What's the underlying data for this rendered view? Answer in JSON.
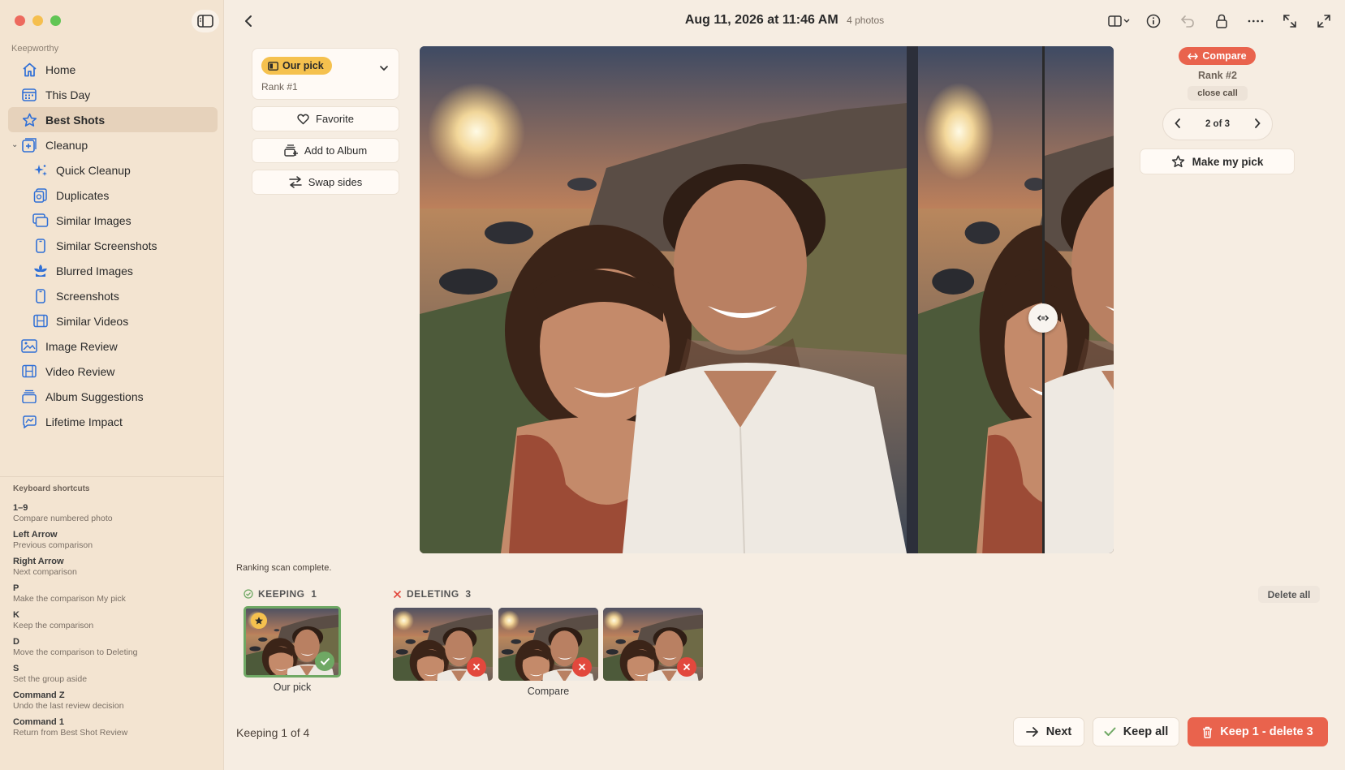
{
  "sidebar": {
    "app_name": "Keepworthy",
    "items": [
      {
        "label": "Home",
        "icon": "home-icon"
      },
      {
        "label": "This Day",
        "icon": "calendar-icon"
      },
      {
        "label": "Best Shots",
        "icon": "star-icon",
        "active": true
      },
      {
        "label": "Cleanup",
        "icon": "cleanup-icon",
        "expanded": true
      },
      {
        "label": "Quick Cleanup",
        "icon": "sparkle-icon",
        "sub": true
      },
      {
        "label": "Duplicates",
        "icon": "duplicates-icon",
        "sub": true
      },
      {
        "label": "Similar Images",
        "icon": "similar-images-icon",
        "sub": true
      },
      {
        "label": "Similar Screenshots",
        "icon": "phone-icon",
        "sub": true
      },
      {
        "label": "Blurred Images",
        "icon": "flower-icon",
        "sub": true
      },
      {
        "label": "Screenshots",
        "icon": "phone-icon",
        "sub": true
      },
      {
        "label": "Similar Videos",
        "icon": "film-icon",
        "sub": true
      },
      {
        "label": "Image Review",
        "icon": "image-review-icon"
      },
      {
        "label": "Video Review",
        "icon": "film-icon"
      },
      {
        "label": "Album Suggestions",
        "icon": "album-icon"
      },
      {
        "label": "Lifetime Impact",
        "icon": "impact-icon"
      }
    ],
    "shortcuts_title": "Keyboard shortcuts",
    "shortcuts": [
      {
        "key": "1–9",
        "desc": "Compare numbered photo"
      },
      {
        "key": "Left  Arrow",
        "desc": "Previous comparison"
      },
      {
        "key": "Right  Arrow",
        "desc": "Next comparison"
      },
      {
        "key": "P",
        "desc": "Make the comparison My pick"
      },
      {
        "key": "K",
        "desc": "Keep the comparison"
      },
      {
        "key": "D",
        "desc": "Move the comparison to Deleting"
      },
      {
        "key": "S",
        "desc": "Set the group aside"
      },
      {
        "key": "Command  Z",
        "desc": "Undo the last review decision"
      },
      {
        "key": "Command  1",
        "desc": "Return from Best Shot Review"
      }
    ]
  },
  "header": {
    "title": "Aug 11, 2026 at 11:46 AM",
    "subtitle": "4 photos"
  },
  "left_panel": {
    "pick_badge": "Our pick",
    "rank": "Rank #1",
    "favorite": "Favorite",
    "add_to_album": "Add to Album",
    "swap_sides": "Swap sides"
  },
  "right_panel": {
    "compare_badge": "Compare",
    "rank": "Rank #2",
    "tag": "close call",
    "pager": "2 of 3",
    "make_pick": "Make my pick"
  },
  "compare": {
    "split_fraction": 0.895
  },
  "bottom": {
    "scan_status": "Ranking scan complete.",
    "keeping_label": "KEEPING",
    "keeping_count": "1",
    "deleting_label": "DELETING",
    "deleting_count": "3",
    "delete_all": "Delete all",
    "keep_caption": "Our pick",
    "compare_caption": "Compare",
    "status": "Keeping 1 of 4",
    "next": "Next",
    "keep_all": "Keep all",
    "primary": "Keep 1 - delete 3"
  },
  "colors": {
    "accent": "#e9634d",
    "pick": "#f5c14e",
    "keep": "#6fa864",
    "delete": "#e2483d"
  }
}
